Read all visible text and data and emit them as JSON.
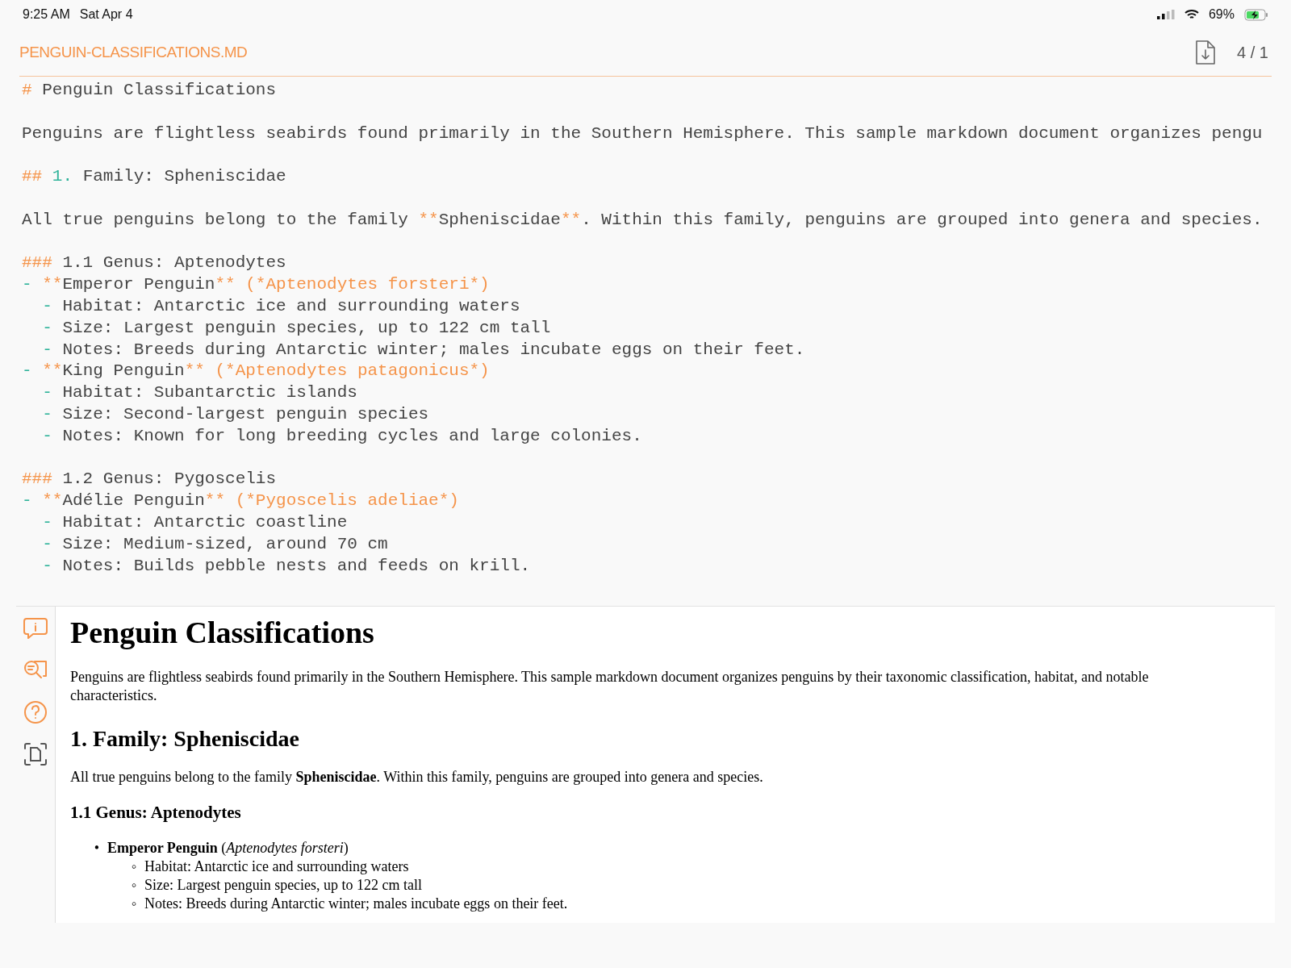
{
  "status_bar": {
    "time": "9:25 AM",
    "date": "Sat Apr 4",
    "battery": "69%"
  },
  "header": {
    "filename": "PENGUIN-CLASSIFICATIONS.MD",
    "page_count": "4 / 1"
  },
  "source_lines": [
    {
      "kind": "code",
      "parts": [
        {
          "kind": "mark",
          "t": "#"
        },
        {
          "kind": "text",
          "t": " Penguin Classifications"
        }
      ]
    },
    {
      "kind": "blank"
    },
    {
      "kind": "code",
      "parts": [
        {
          "kind": "text",
          "t": "Penguins are flightless seabirds found primarily in the Southern Hemisphere. This sample markdown document organizes pengu"
        }
      ]
    },
    {
      "kind": "blank"
    },
    {
      "kind": "code",
      "parts": [
        {
          "kind": "mark",
          "t": "##"
        },
        {
          "kind": "num",
          "t": " 1."
        },
        {
          "kind": "text",
          "t": " Family: Spheniscidae"
        }
      ]
    },
    {
      "kind": "blank"
    },
    {
      "kind": "code",
      "parts": [
        {
          "kind": "text",
          "t": "All true penguins belong to the family "
        },
        {
          "kind": "mark",
          "t": "**"
        },
        {
          "kind": "text",
          "t": "Spheniscidae"
        },
        {
          "kind": "mark",
          "t": "**"
        },
        {
          "kind": "text",
          "t": ". Within this family, penguins are grouped into genera and species."
        }
      ]
    },
    {
      "kind": "blank"
    },
    {
      "kind": "code",
      "parts": [
        {
          "kind": "mark",
          "t": "###"
        },
        {
          "kind": "text",
          "t": " 1.1 Genus: Aptenodytes"
        }
      ]
    },
    {
      "kind": "code",
      "parts": [
        {
          "kind": "num",
          "t": "-"
        },
        {
          "kind": "mark",
          "t": " **"
        },
        {
          "kind": "text",
          "t": "Emperor Penguin"
        },
        {
          "kind": "mark",
          "t": "** (*Aptenodytes forsteri*)"
        }
      ]
    },
    {
      "kind": "code",
      "parts": [
        {
          "kind": "num",
          "t": "  -"
        },
        {
          "kind": "text",
          "t": " Habitat: Antarctic ice and surrounding waters"
        }
      ]
    },
    {
      "kind": "code",
      "parts": [
        {
          "kind": "num",
          "t": "  -"
        },
        {
          "kind": "text",
          "t": " Size: Largest penguin species, up to 122 cm tall"
        }
      ]
    },
    {
      "kind": "code",
      "parts": [
        {
          "kind": "num",
          "t": "  -"
        },
        {
          "kind": "text",
          "t": " Notes: Breeds during Antarctic winter; males incubate eggs on their feet."
        }
      ]
    },
    {
      "kind": "code",
      "parts": [
        {
          "kind": "num",
          "t": "-"
        },
        {
          "kind": "mark",
          "t": " **"
        },
        {
          "kind": "text",
          "t": "King Penguin"
        },
        {
          "kind": "mark",
          "t": "** (*Aptenodytes patagonicus*)"
        }
      ]
    },
    {
      "kind": "code",
      "parts": [
        {
          "kind": "num",
          "t": "  -"
        },
        {
          "kind": "text",
          "t": " Habitat: Subantarctic islands"
        }
      ]
    },
    {
      "kind": "code",
      "parts": [
        {
          "kind": "num",
          "t": "  -"
        },
        {
          "kind": "text",
          "t": " Size: Second-largest penguin species"
        }
      ]
    },
    {
      "kind": "code",
      "parts": [
        {
          "kind": "num",
          "t": "  -"
        },
        {
          "kind": "text",
          "t": " Notes: Known for long breeding cycles and large colonies."
        }
      ]
    },
    {
      "kind": "blank"
    },
    {
      "kind": "code",
      "parts": [
        {
          "kind": "mark",
          "t": "###"
        },
        {
          "kind": "text",
          "t": " 1.2 Genus: Pygoscelis"
        }
      ]
    },
    {
      "kind": "code",
      "parts": [
        {
          "kind": "num",
          "t": "-"
        },
        {
          "kind": "mark",
          "t": " **"
        },
        {
          "kind": "text",
          "t": "Adélie Penguin"
        },
        {
          "kind": "mark",
          "t": "** (*Pygoscelis adeliae*)"
        }
      ]
    },
    {
      "kind": "code",
      "parts": [
        {
          "kind": "num",
          "t": "  -"
        },
        {
          "kind": "text",
          "t": " Habitat: Antarctic coastline"
        }
      ]
    },
    {
      "kind": "code",
      "parts": [
        {
          "kind": "num",
          "t": "  -"
        },
        {
          "kind": "text",
          "t": " Size: Medium-sized, around 70 cm"
        }
      ]
    },
    {
      "kind": "code",
      "parts": [
        {
          "kind": "num",
          "t": "  -"
        },
        {
          "kind": "text",
          "t": " Notes: Builds pebble nests and feeds on krill."
        }
      ]
    }
  ],
  "preview": [
    {
      "kind": "h1",
      "text": "Penguin Classifications"
    },
    {
      "kind": "p",
      "text": "Penguins are flightless seabirds found primarily in the Southern Hemisphere. This sample markdown document organizes penguins by their taxonomic classification, habitat, and notable characteristics."
    },
    {
      "kind": "h2",
      "text": "1. Family: Spheniscidae"
    },
    {
      "kind": "p",
      "text": "All true penguins belong to the family **Spheniscidae**. Within this family, penguins are grouped into genera and species."
    },
    {
      "kind": "h3",
      "text": "1.1 Genus: Aptenodytes"
    },
    {
      "kind": "list",
      "items": [
        {
          "marker": "•",
          "text": "**Emperor Penguin** (*Aptenodytes forsteri*)",
          "children": [
            {
              "marker": "◦",
              "text": "Habitat: Antarctic ice and surrounding waters"
            },
            {
              "marker": "◦",
              "text": "Size: Largest penguin species, up to 122 cm tall"
            },
            {
              "marker": "◦",
              "text": "Notes: Breeds during Antarctic winter; males incubate eggs on their feet."
            }
          ]
        }
      ]
    }
  ]
}
